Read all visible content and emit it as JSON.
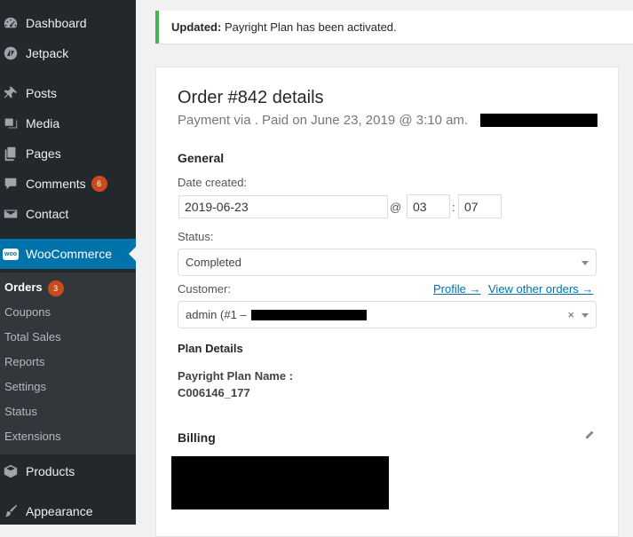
{
  "sidebar": {
    "items": [
      {
        "label": "Dashboard",
        "icon": "dashboard-icon"
      },
      {
        "label": "Jetpack",
        "icon": "jetpack-icon"
      },
      {
        "label": "Posts",
        "icon": "pin-icon"
      },
      {
        "label": "Media",
        "icon": "media-icon"
      },
      {
        "label": "Pages",
        "icon": "pages-icon"
      },
      {
        "label": "Comments",
        "icon": "comment-icon",
        "badge": "6"
      },
      {
        "label": "Contact",
        "icon": "envelope-icon"
      },
      {
        "label": "WooCommerce",
        "icon": "woo-icon"
      },
      {
        "label": "Products",
        "icon": "box-icon"
      },
      {
        "label": "Appearance",
        "icon": "brush-icon"
      }
    ],
    "submenu": [
      {
        "label": "Orders",
        "badge": "3"
      },
      {
        "label": "Coupons"
      },
      {
        "label": "Total Sales"
      },
      {
        "label": "Reports"
      },
      {
        "label": "Settings"
      },
      {
        "label": "Status"
      },
      {
        "label": "Extensions"
      }
    ],
    "woo_icon_text": "woo"
  },
  "notice": {
    "prefix": "Updated:",
    "message": " Payright Plan has been activated."
  },
  "order": {
    "title": "Order #842 details",
    "subtitle": "Payment via . Paid on June 23, 2019 @ 3:10 am."
  },
  "general": {
    "heading": "General",
    "date_label": "Date created:",
    "date_value": "2019-06-23",
    "at_sign": "@",
    "hour": "03",
    "colon": ":",
    "minute": "07",
    "status_label": "Status:",
    "status_value": "Completed",
    "customer_label": "Customer:",
    "profile_link": "Profile →",
    "other_orders_link": "View other orders →",
    "customer_value": "admin (#1 –",
    "clear_symbol": "×"
  },
  "plan": {
    "heading": "Plan Details",
    "name_label": "Payright Plan Name :",
    "name_value": "C006146_177"
  },
  "billing": {
    "heading": "Billing"
  },
  "colors": {
    "sidebar_bg": "#23282d",
    "submenu_bg": "#32373c",
    "active_bg": "#0073aa",
    "badge": "#ca4a1f",
    "notice_border": "#46b450",
    "link": "#0073aa"
  }
}
